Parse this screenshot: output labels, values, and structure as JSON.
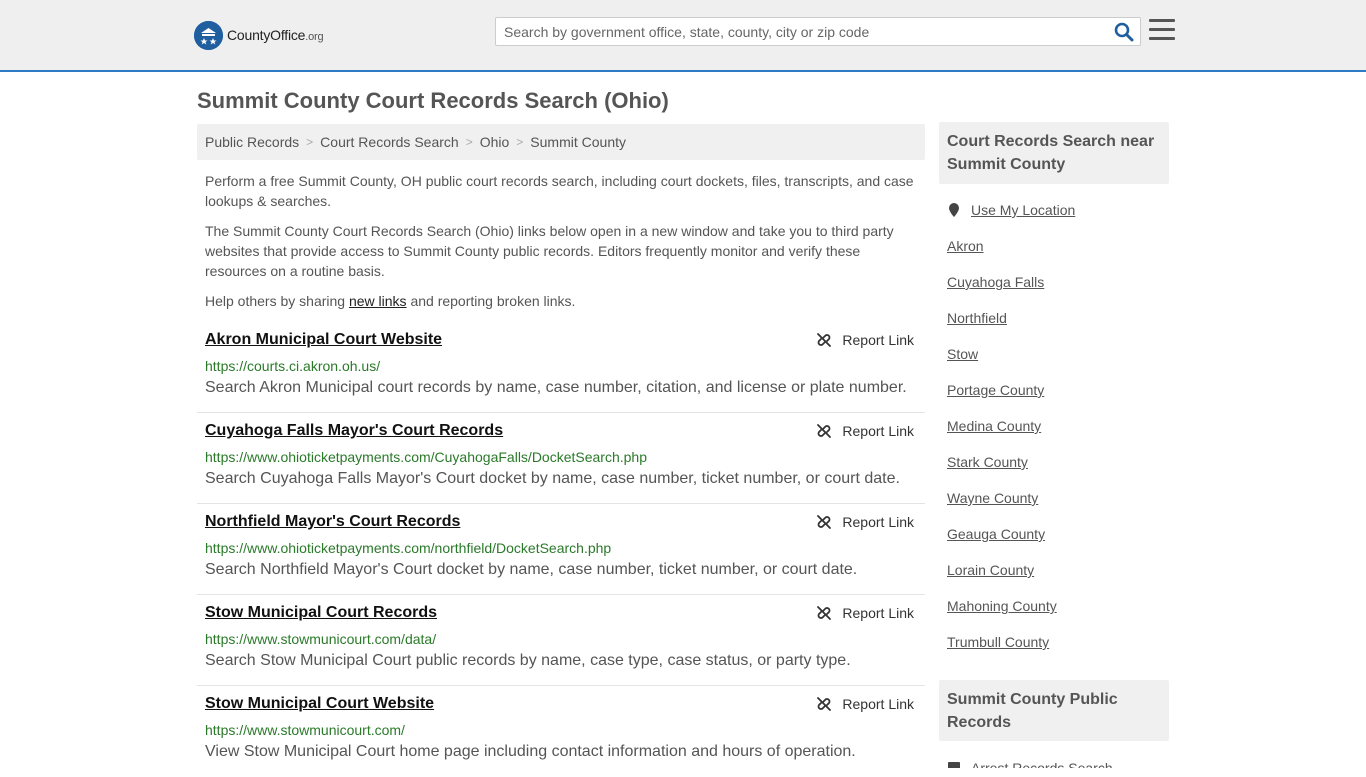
{
  "header": {
    "logo_text_main": "CountyOffice",
    "logo_text_suffix": ".org",
    "search_placeholder": "Search by government office, state, county, city or zip code"
  },
  "page_title": "Summit County Court Records Search (Ohio)",
  "breadcrumb": [
    "Public Records",
    "Court Records Search",
    "Ohio",
    "Summit County"
  ],
  "intro": {
    "p1": "Perform a free Summit County, OH public court records search, including court dockets, files, transcripts, and case lookups & searches.",
    "p2": "The Summit County Court Records Search (Ohio) links below open in a new window and take you to third party websites that provide access to Summit County public records. Editors frequently monitor and verify these resources on a routine basis.",
    "p3_before": "Help others by sharing ",
    "p3_link": "new links",
    "p3_after": " and reporting broken links."
  },
  "report_label": "Report Link",
  "results": [
    {
      "title": "Akron Municipal Court Website",
      "url": "https://courts.ci.akron.oh.us/",
      "desc": "Search Akron Municipal court records by name, case number, citation, and license or plate number."
    },
    {
      "title": "Cuyahoga Falls Mayor's Court Records",
      "url": "https://www.ohioticketpayments.com/CuyahogaFalls/DocketSearch.php",
      "desc": "Search Cuyahoga Falls Mayor's Court docket by name, case number, ticket number, or court date."
    },
    {
      "title": "Northfield Mayor's Court Records",
      "url": "https://www.ohioticketpayments.com/northfield/DocketSearch.php",
      "desc": "Search Northfield Mayor's Court docket by name, case number, ticket number, or court date."
    },
    {
      "title": "Stow Municipal Court Records",
      "url": "https://www.stowmunicourt.com/data/",
      "desc": "Search Stow Municipal Court public records by name, case type, case status, or party type."
    },
    {
      "title": "Stow Municipal Court Website",
      "url": "https://www.stowmunicourt.com/",
      "desc": "View Stow Municipal Court home page including contact information and hours of operation."
    }
  ],
  "sidebar": {
    "nearby_title": "Court Records Search near Summit County",
    "use_location": "Use My Location",
    "nearby": [
      "Akron",
      "Cuyahoga Falls",
      "Northfield",
      "Stow",
      "Portage County",
      "Medina County",
      "Stark County",
      "Wayne County",
      "Geauga County",
      "Lorain County",
      "Mahoning County",
      "Trumbull County"
    ],
    "public_records_title": "Summit County Public Records",
    "public_records": [
      "Arrest Records Search"
    ]
  }
}
